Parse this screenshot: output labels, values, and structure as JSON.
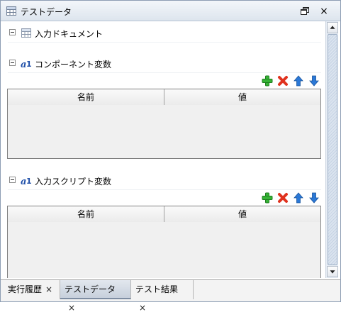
{
  "window": {
    "title": "テストデータ",
    "title_icon": "grid-icon",
    "restore_icon": "restore-window-icon",
    "close_label": "×"
  },
  "sections": [
    {
      "label": "入力ドキュメント",
      "icon": "grid-icon",
      "expanded": true
    },
    {
      "label": "コンポーネント変数",
      "icon": "variable-icon",
      "expanded": true,
      "toolbar": [
        "add-icon",
        "delete-icon",
        "move-up-icon",
        "move-down-icon"
      ],
      "columns": [
        "名前",
        "値"
      ],
      "rows": []
    },
    {
      "label": "入力スクリプト変数",
      "icon": "variable-icon",
      "expanded": true,
      "toolbar": [
        "add-icon",
        "delete-icon",
        "move-up-icon",
        "move-down-icon"
      ],
      "columns": [
        "名前",
        "値"
      ],
      "rows": []
    }
  ],
  "tabs": [
    {
      "label": "実行履歴",
      "active": false,
      "close": "×"
    },
    {
      "label": "テストデータ",
      "active": true,
      "close": "×"
    },
    {
      "label": "テスト結果",
      "active": false,
      "close": "×"
    }
  ],
  "colors": {
    "add": "#2fa52f",
    "delete": "#e0321e",
    "arrow": "#2b78d6",
    "accent_border": "#8d9db3"
  }
}
